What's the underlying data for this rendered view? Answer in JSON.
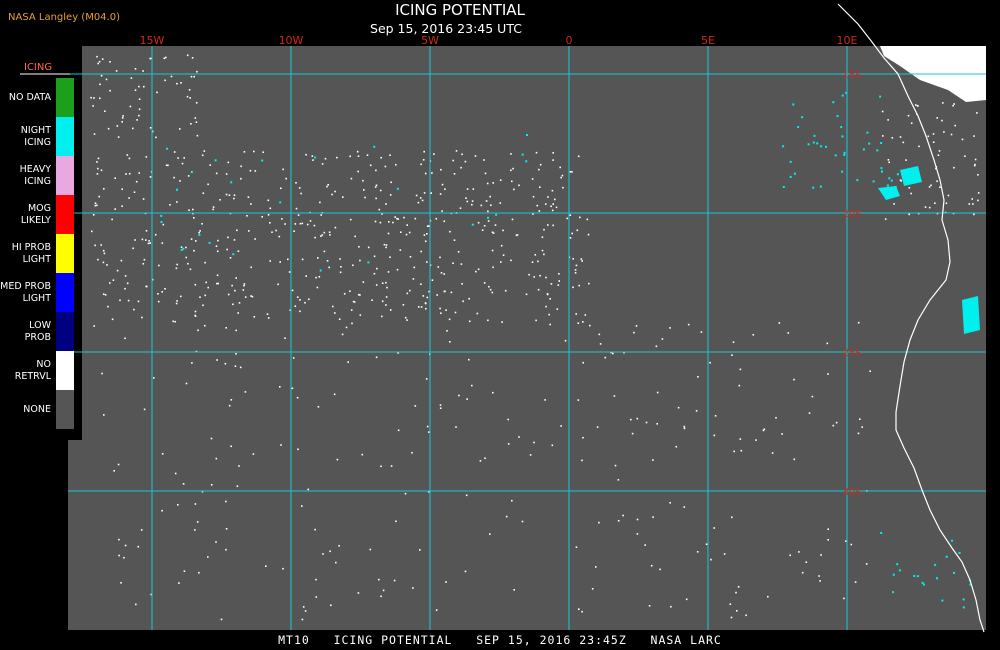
{
  "header": {
    "source": "NASA Langley (M04.0)",
    "title": "ICING POTENTIAL",
    "subtitle": "Sep 15, 2016 23:45 UTC"
  },
  "footer": {
    "text": "MT10   ICING POTENTIAL   SEP 15, 2016 23:45Z   NASA LARC"
  },
  "map": {
    "background_color": "#555555",
    "grid_color": "#19c8d6",
    "grid_label_color": "#cc2a1a",
    "longitude_labels": [
      "15W",
      "10W",
      "5W",
      "0",
      "5E",
      "10E"
    ],
    "latitude_labels": [
      "15S",
      "20S",
      "25S",
      "30S"
    ],
    "coastline": "west coast of southern Africa (Angola / Namibia)"
  },
  "legend": {
    "title": "ICING",
    "items": [
      {
        "label": "NO DATA",
        "color": "#1ca01c"
      },
      {
        "label": "NIGHT\nICING",
        "color": "#00f0f0"
      },
      {
        "label": "HEAVY\nICING",
        "color": "#e8a8e0"
      },
      {
        "label": "MOG\nLIKELY",
        "color": "#ff0000"
      },
      {
        "label": "HI PROB\nLIGHT",
        "color": "#ffff00"
      },
      {
        "label": "MED PROB\nLIGHT",
        "color": "#0000ff"
      },
      {
        "label": "LOW\nPROB",
        "color": "#000080"
      },
      {
        "label": "NO\nRETRVL",
        "color": "#ffffff"
      },
      {
        "label": "NONE",
        "color": "#555555"
      }
    ]
  }
}
